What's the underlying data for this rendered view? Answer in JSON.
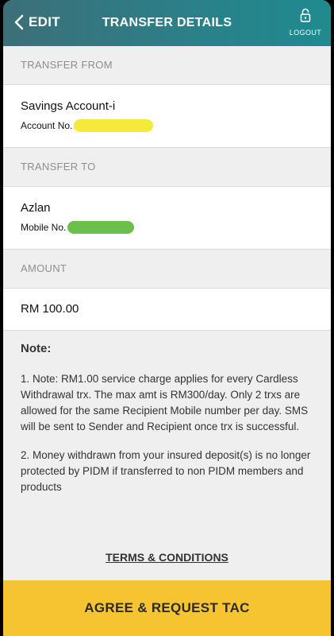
{
  "header": {
    "back_label": "EDIT",
    "title": "TRANSFER DETAILS",
    "logout_label": "LOGOUT"
  },
  "transfer_from": {
    "section_label": "TRANSFER FROM",
    "account_name": "Savings Account-i",
    "account_no_label": "Account No."
  },
  "transfer_to": {
    "section_label": "TRANSFER TO",
    "recipient_name": "Azlan",
    "mobile_no_label": "Mobile No."
  },
  "amount": {
    "section_label": "AMOUNT",
    "value": "RM 100.00"
  },
  "note": {
    "title": "Note:",
    "items": [
      "1. Note: RM1.00 service charge applies for every Cardless Withdrawal trx. The max amt is RM300/day. Only 2 trxs are allowed for the same Recipient Mobile number per day. SMS will be sent to Sender and Recipient once trx is successful.",
      "2. Money withdrawn from your insured deposit(s) is no longer protected by PIDM if transferred to non PIDM members and products"
    ]
  },
  "terms_label": "TERMS & CONDITIONS",
  "cta_label": "AGREE & REQUEST TAC",
  "colors": {
    "header_start": "#3c6f78",
    "header_end": "#1f8b8f",
    "cta": "#f7c431",
    "redact_account": "#f5e93a",
    "redact_mobile": "#6cc04a"
  },
  "icons": {
    "back": "chevron-left-icon",
    "logout": "lock-icon"
  }
}
